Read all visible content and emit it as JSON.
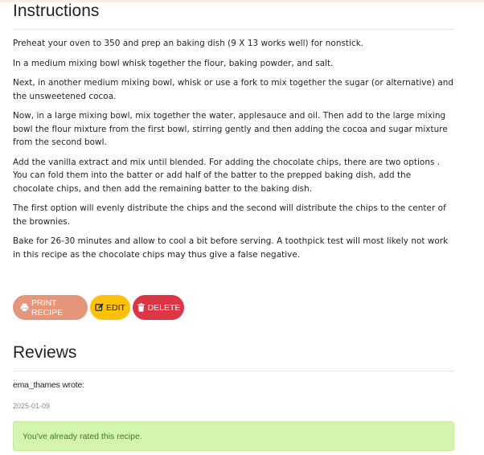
{
  "instructions": {
    "title": "Instructions",
    "steps": [
      "Preheat your oven to 350 and prep an baking dish (9 X 13 works well) for nonstick.",
      "In a medium mixing bowl whisk together the flour, baking powder, and salt.",
      "Next, in another medium mixing bowl, whisk or use a fork to mix together the sugar (or alternative) and the unsweetened cocoa.",
      "Now, in a large mixing bowl, mix together the water, applesauce and oil. Then add to the large mixing bowl the flour mixture from the first bowl, stirring gently and then adding the cocoa and sugar mixture from the second bowl.",
      "Add the vanilla extract and mix until blended. For adding the chocolate chips, there are two options . You can fold them into the batter or add half of the batter to the prepped baking dish, add the chocolate chips, and then add the remaining batter to the baking dish.",
      "The first option will evenly distribute the chips and the second will distribute the chips to the center of the brownies.",
      "Bake for 26-30 minutes and allow to cool a bit before serving. A toothpick test will most likely not work in this recipe as the chocolate chips may thus give a false negative."
    ]
  },
  "actions": {
    "print_label": "PRINT RECIPE",
    "edit_label": "EDIT",
    "delete_label": "DELETE",
    "print_color": "#e5967a",
    "edit_color": "#ffc107",
    "delete_color": "#dc3545",
    "print_icon": "printer-icon",
    "edit_icon": "edit-icon",
    "delete_icon": "trash-icon"
  },
  "reviews": {
    "title": "Reviews",
    "author_line": "ema_thames wrote:",
    "date": "2025-01-09",
    "alert_text": "You've already rated this recipe.",
    "alert_color": "#d4f5b0"
  }
}
